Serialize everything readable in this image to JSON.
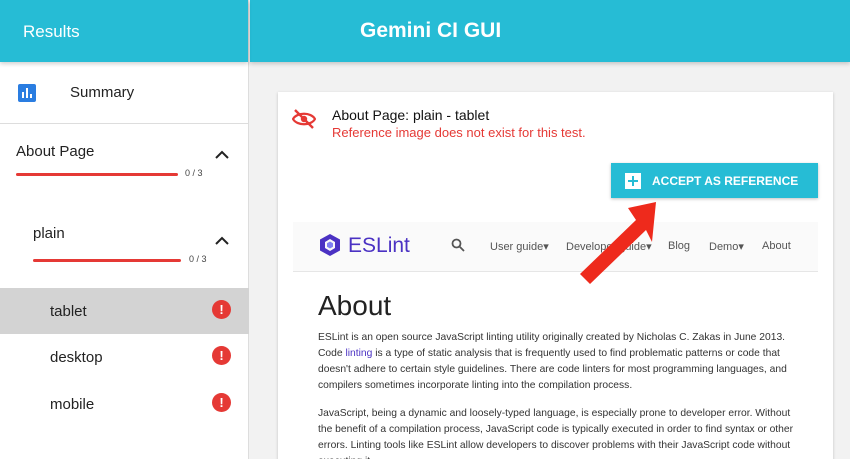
{
  "sidebar": {
    "title": "Results",
    "summary_label": "Summary",
    "suite": {
      "name": "About Page",
      "count": "0 / 3",
      "progress": 0
    },
    "state": {
      "name": "plain",
      "count": "0 / 3",
      "progress": 0
    },
    "browsers": [
      {
        "name": "tablet",
        "selected": true,
        "status": "!"
      },
      {
        "name": "desktop",
        "selected": false,
        "status": "!"
      },
      {
        "name": "mobile",
        "selected": false,
        "status": "!"
      }
    ]
  },
  "header": {
    "title": "Gemini CI GUI"
  },
  "test": {
    "title": "About Page: plain - tablet",
    "error": "Reference image does not exist for this test.",
    "accept_label": "ACCEPT AS REFERENCE"
  },
  "screenshot": {
    "logo_text": "ESLint",
    "nav": [
      "User guide▾",
      "Developer guide▾",
      "Blog",
      "Demo▾",
      "About"
    ],
    "heading": "About",
    "para1_a": "ESLint is an open source JavaScript linting utility originally created by Nicholas C. Zakas in June 2013. Code ",
    "para1_link": "linting",
    "para1_b": " is a type of static analysis that is frequently used to find problematic patterns or code that doesn't adhere to certain style guidelines. There are code linters for most programming languages, and compilers sometimes incorporate linting into the compilation process.",
    "para2": "JavaScript, being a dynamic and loosely-typed language, is especially prone to developer error. Without the benefit of a compilation process, JavaScript code is typically executed in order to find syntax or other errors. Linting tools like ESLint allow developers to discover problems with their JavaScript code without executing it."
  },
  "colors": {
    "accent": "#26bcd5",
    "error": "#e53935",
    "eslint": "#4b32c3"
  }
}
